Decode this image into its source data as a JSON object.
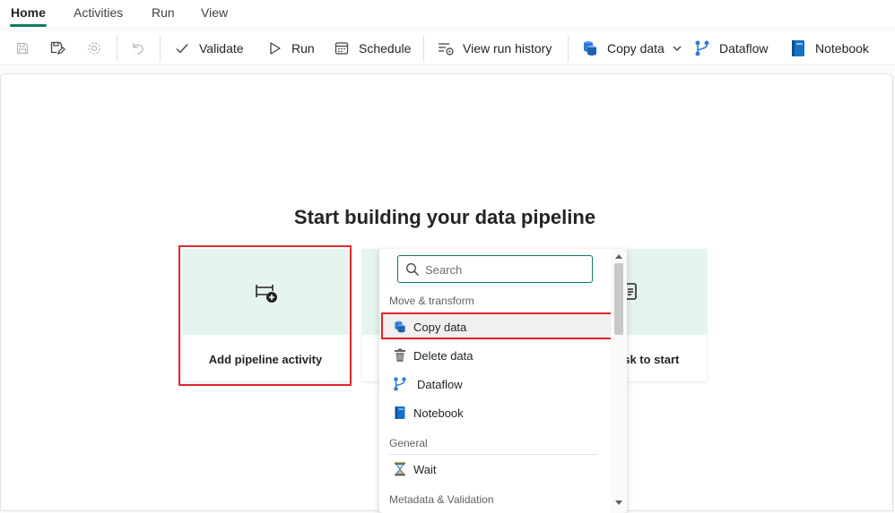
{
  "tabs": [
    {
      "label": "Home",
      "active": true
    },
    {
      "label": "Activities",
      "active": false
    },
    {
      "label": "Run",
      "active": false
    },
    {
      "label": "View",
      "active": false
    }
  ],
  "toolbar": {
    "validate": "Validate",
    "run": "Run",
    "schedule": "Schedule",
    "view_run_history": "View run history",
    "copy_data": "Copy data",
    "dataflow": "Dataflow",
    "notebook": "Notebook"
  },
  "main": {
    "heading": "Start building your data pipeline",
    "cards": [
      {
        "label": "Add pipeline activity",
        "icon": "pipeline-add-icon"
      },
      {
        "label": "",
        "icon": ""
      },
      {
        "label": "ask to start",
        "icon": "document-icon"
      }
    ]
  },
  "dropdown": {
    "search_placeholder": "Search",
    "groups": [
      {
        "label": "Move & transform",
        "items": [
          {
            "label": "Copy data",
            "icon": "copy-data-icon",
            "selected": true
          },
          {
            "label": "Delete data",
            "icon": "trash-icon"
          },
          {
            "label": "Dataflow",
            "icon": "dataflow-icon"
          },
          {
            "label": "Notebook",
            "icon": "notebook-icon"
          }
        ]
      },
      {
        "label": "General",
        "items": [
          {
            "label": "Wait",
            "icon": "hourglass-icon"
          }
        ]
      },
      {
        "label": "Metadata & Validation",
        "items": []
      }
    ]
  },
  "colors": {
    "accent": "#117865",
    "highlight": "#e3262c",
    "card_top": "#e5f5ee"
  }
}
